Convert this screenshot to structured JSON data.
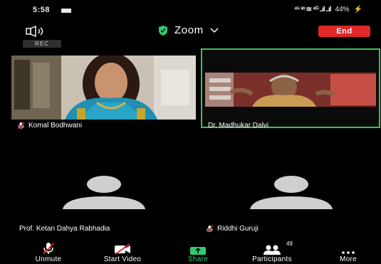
{
  "status_bar": {
    "time": "5:58",
    "right_text": "⁴⁵ ᵛᵒ ≋ ⁴ᴳ ..ıl ..ıl",
    "battery": "44%",
    "charge_symbol": "⚡"
  },
  "meeting": {
    "title": "Zoom",
    "end_label": "End",
    "rec_label": "REC"
  },
  "participants": [
    {
      "name": "Komal Bodhwani",
      "muted": true
    },
    {
      "name": "Dr. Madhukar Dalvi",
      "muted": false
    },
    {
      "name": "Prof. Ketan Dahya Rabhadia",
      "muted": false
    },
    {
      "name": "Riddhi Guruji",
      "muted": true
    }
  ],
  "toolbar": {
    "unmute_label": "Unmute",
    "start_video_label": "Start Video",
    "share_label": "Share",
    "participants_label": "Participants",
    "participants_count": "49",
    "more_label": "More"
  },
  "colors": {
    "end_button": "#e02828",
    "active_speaker_border": "#3cc15a",
    "share_green": "#2ecc71",
    "avatar_gray": "#cfcfcf"
  },
  "icons": {
    "speaker": "speaker-icon",
    "shield": "shield-icon",
    "chevron": "chevron-down-icon",
    "mic_off": "mic-off-icon",
    "video_off": "video-off-icon",
    "share": "share-arrow-icon",
    "participants": "participants-icon",
    "more": "more-dots-icon"
  }
}
